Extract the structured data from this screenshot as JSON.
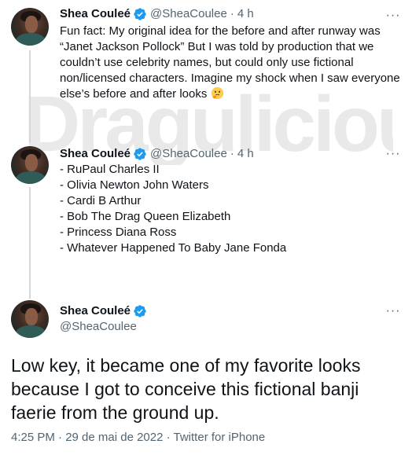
{
  "tweets": [
    {
      "name": "Shea Couleé",
      "handle": "@SheaCoulee",
      "separator": "·",
      "time": "4 h",
      "more": "···",
      "text": "Fun fact: My original idea for the before and after runway was “Janet Jackson Pollock” But I was told by production that we couldn’t use celebrity names, but could only use fictional non/licensed characters. Imagine my shock when I saw everyone else’s before and after looks"
    },
    {
      "name": "Shea Couleé",
      "handle": "@SheaCoulee",
      "separator": "·",
      "time": "4 h",
      "more": "···",
      "lines": [
        "- RuPaul Charles II",
        "- Olivia Newton John Waters",
        "- Cardi B Arthur",
        "- Bob The Drag Queen Elizabeth",
        "- Princess Diana Ross",
        "- Whatever Happened To Baby Jane Fonda"
      ]
    }
  ],
  "main_tweet": {
    "name": "Shea Couleé",
    "handle": "@SheaCoulee",
    "more": "···",
    "text": "Low key, it became one of my favorite looks because I got to conceive this fictional banji faerie from the ground up.",
    "meta": "4:25 PM · 29 de mai de 2022 · Twitter for iPhone"
  },
  "watermark": "Dragulicious",
  "colors": {
    "verified": "#1d9bf0",
    "secondary_text": "#536471",
    "thread_line": "#cfd9de",
    "watermark": "#e8e8e8"
  },
  "icons": [
    "verified-badge-icon",
    "more-options-icon",
    "thinking-face-icon"
  ]
}
